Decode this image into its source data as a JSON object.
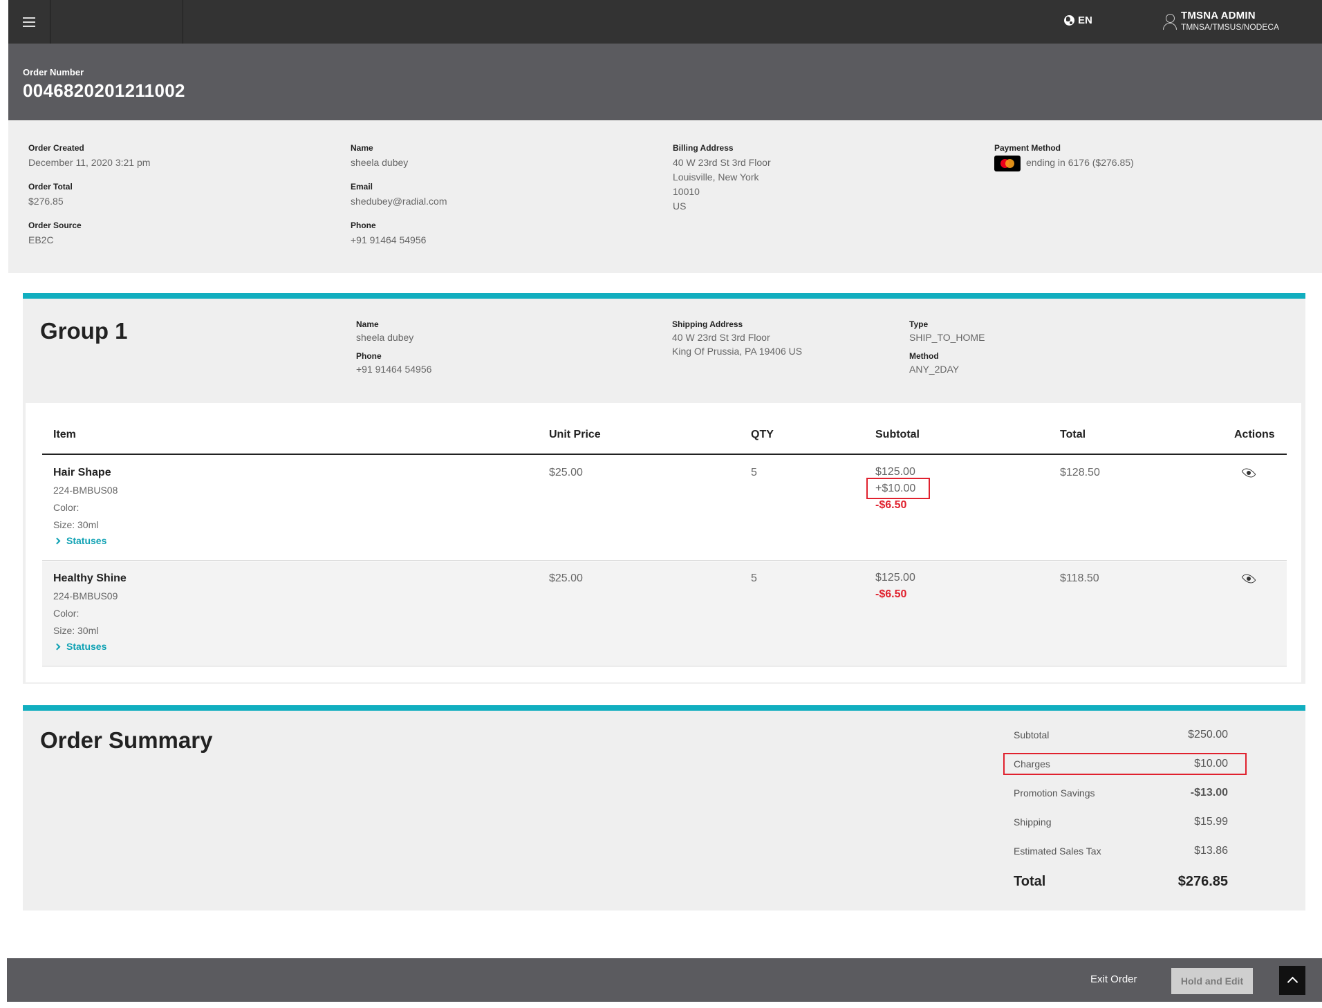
{
  "header": {
    "language": "EN",
    "user_name": "TMSNA ADMIN",
    "user_path": "TMNSA/TMSUS/NODECA"
  },
  "order": {
    "number_label": "Order Number",
    "number": "0046820201211002"
  },
  "info": {
    "created_label": "Order Created",
    "created": "December 11, 2020 3:21 pm",
    "total_label": "Order Total",
    "total": "$276.85",
    "source_label": "Order Source",
    "source": "EB2C",
    "name_label": "Name",
    "name": "sheela dubey",
    "email_label": "Email",
    "email": "shedubey@radial.com",
    "phone_label": "Phone",
    "phone": "+91 91464 54956",
    "billing_label": "Billing Address",
    "billing_line1": "40 W 23rd St 3rd Floor",
    "billing_line2": "Louisville, New York",
    "billing_line3": "10010",
    "billing_line4": "US",
    "payment_label": "Payment Method",
    "payment_text": "ending in 6176 ($276.85)"
  },
  "group": {
    "title": "Group 1",
    "name_label": "Name",
    "name": "sheela dubey",
    "phone_label": "Phone",
    "phone": "+91 91464 54956",
    "shipping_label": "Shipping Address",
    "shipping_line1": "40 W 23rd St 3rd Floor",
    "shipping_line2": "King Of Prussia, PA 19406 US",
    "type_label": "Type",
    "type": "SHIP_TO_HOME",
    "method_label": "Method",
    "method": "ANY_2DAY",
    "columns": [
      "Item",
      "Unit Price",
      "QTY",
      "Subtotal",
      "Total",
      "Actions"
    ],
    "items": [
      {
        "name": "Hair Shape",
        "sku": "224-BMBUS08",
        "color": "Color:",
        "size": "Size: 30ml",
        "statuses": "Statuses",
        "unit_price": "$25.00",
        "qty": "5",
        "subtotal": "$125.00",
        "charge": "+$10.00",
        "discount": "-$6.50",
        "total": "$128.50"
      },
      {
        "name": "Healthy Shine",
        "sku": "224-BMBUS09",
        "color": "Color:",
        "size": "Size: 30ml",
        "statuses": "Statuses",
        "unit_price": "$25.00",
        "qty": "5",
        "subtotal": "$125.00",
        "discount": "-$6.50",
        "total": "$118.50"
      }
    ]
  },
  "summary": {
    "title": "Order Summary",
    "subtotal_label": "Subtotal",
    "subtotal": "$250.00",
    "charges_label": "Charges",
    "charges": "$10.00",
    "promo_label": "Promotion Savings",
    "promo": "-$13.00",
    "shipping_label": "Shipping",
    "shipping": "$15.99",
    "tax_label": "Estimated Sales Tax",
    "tax": "$13.86",
    "total_label": "Total",
    "total": "$276.85"
  },
  "footer": {
    "exit_label": "Exit Order",
    "hold_label": "Hold and Edit"
  },
  "colors": {
    "accent": "#11aebf",
    "negative": "#e0212e"
  }
}
